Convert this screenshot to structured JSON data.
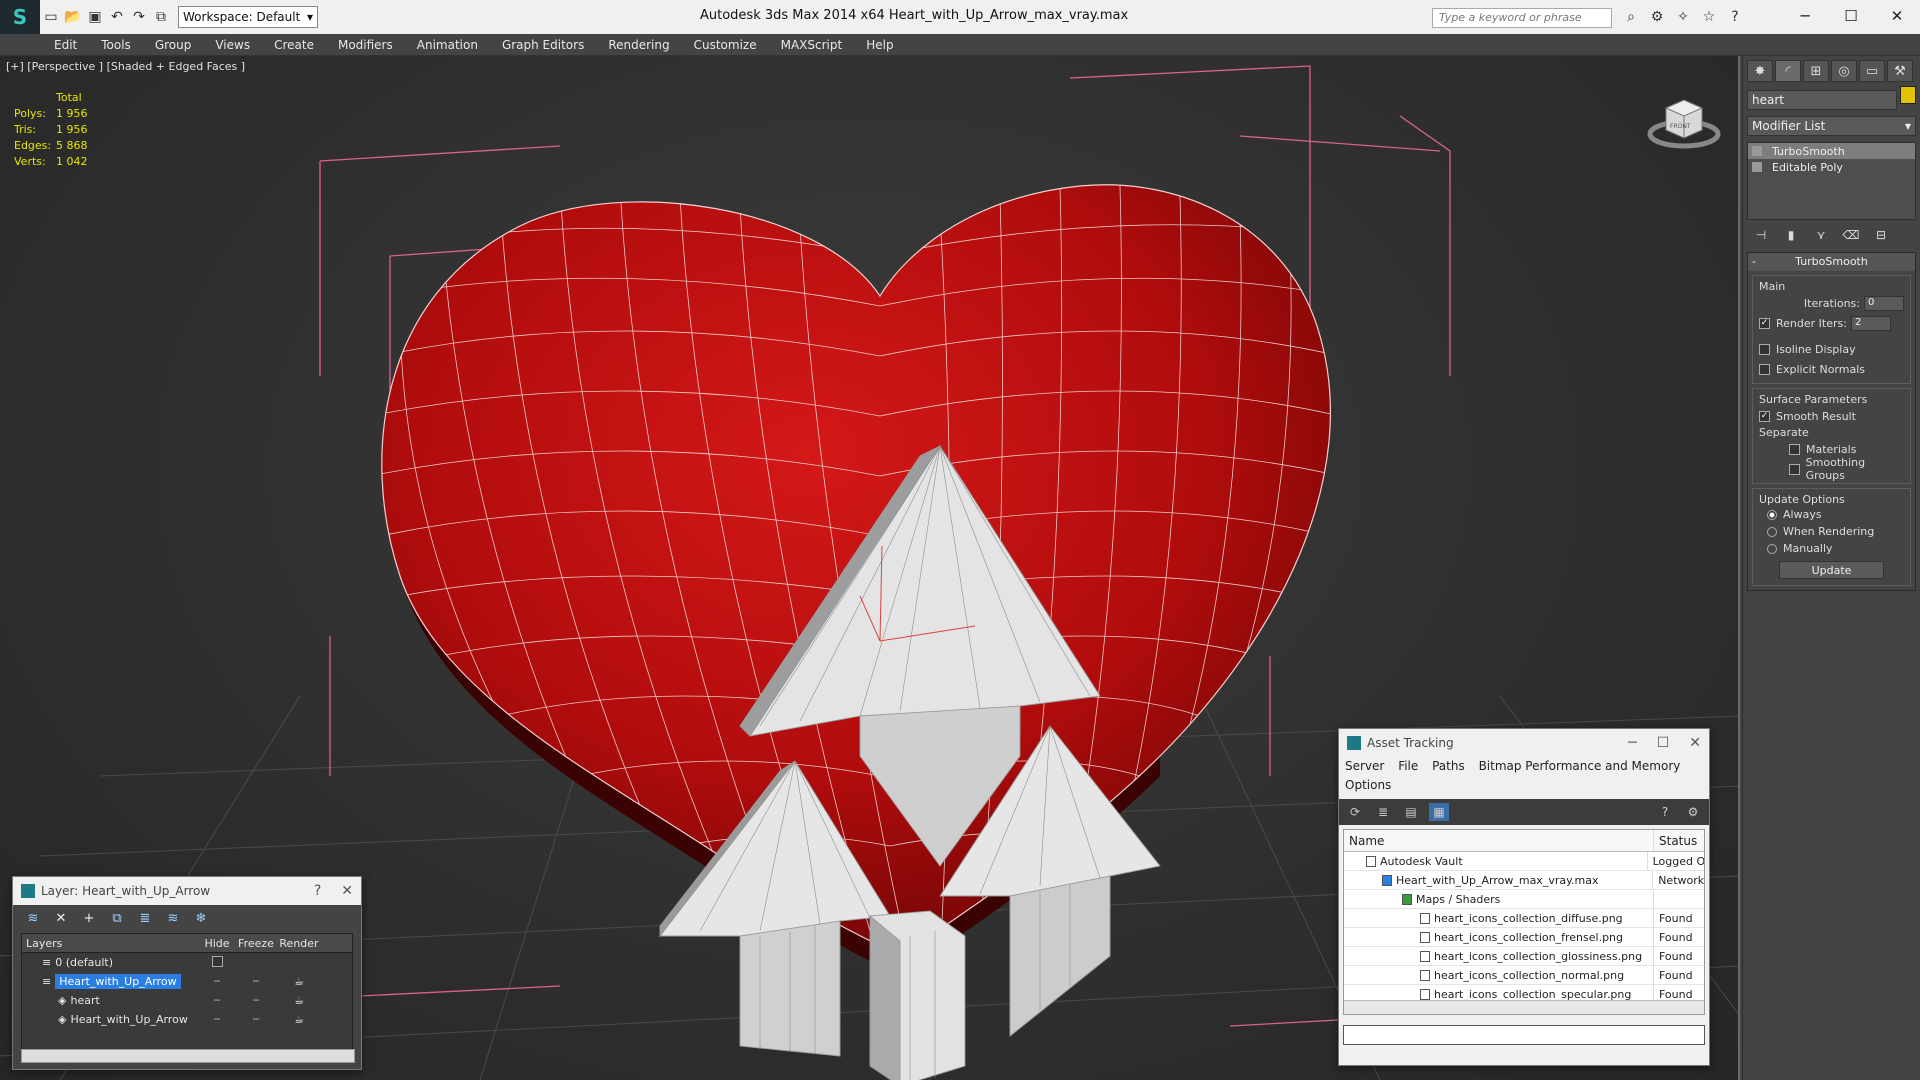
{
  "titlebar": {
    "title": "Autodesk 3ds Max  2014 x64      Heart_with_Up_Arrow_max_vray.max",
    "workspace": "Workspace: Default",
    "search_placeholder": "Type a keyword or phrase"
  },
  "menu": [
    "Edit",
    "Tools",
    "Group",
    "Views",
    "Create",
    "Modifiers",
    "Animation",
    "Graph Editors",
    "Rendering",
    "Customize",
    "MAXScript",
    "Help"
  ],
  "viewport": {
    "label": "[+] [Perspective ] [Shaded + Edged Faces ]",
    "stats_header": "Total",
    "stats": [
      {
        "k": "Polys:",
        "v": "1 956"
      },
      {
        "k": "Tris:",
        "v": "1 956"
      },
      {
        "k": "Edges:",
        "v": "5 868"
      },
      {
        "k": "Verts:",
        "v": "1 042"
      }
    ],
    "viewcube_label": "FRONT"
  },
  "command_panel": {
    "object_name": "heart",
    "object_color": "#e2c300",
    "modifier_list": "Modifier List",
    "stack": [
      {
        "label": "TurboSmooth",
        "selected": true
      },
      {
        "label": "Editable Poly",
        "selected": false
      }
    ],
    "rollout_title": "TurboSmooth",
    "main_title": "Main",
    "iterations_label": "Iterations:",
    "iterations_value": "0",
    "render_iters_label": "Render Iters:",
    "render_iters_value": "2",
    "isoline_label": "Isoline Display",
    "explicit_normals_label": "Explicit Normals",
    "surface_title": "Surface Parameters",
    "smooth_result_label": "Smooth Result",
    "separate_label": "Separate",
    "materials_label": "Materials",
    "smoothing_groups_label": "Smoothing Groups",
    "update_title": "Update Options",
    "always_label": "Always",
    "when_rendering_label": "When Rendering",
    "manually_label": "Manually",
    "update_button": "Update"
  },
  "layer_dialog": {
    "title": "Layer: Heart_with_Up_Arrow",
    "help": "?",
    "close": "✕",
    "columns": [
      "Layers",
      "Hide",
      "Freeze",
      "Render"
    ],
    "rows": [
      {
        "name": "0 (default)",
        "indent": 0
      },
      {
        "name": "Heart_with_Up_Arrow",
        "indent": 0
      },
      {
        "name": "heart",
        "indent": 1
      },
      {
        "name": "Heart_with_Up_Arrow",
        "indent": 1
      }
    ]
  },
  "asset_dialog": {
    "title": "Asset Tracking",
    "menu": [
      "Server",
      "File",
      "Paths",
      "Bitmap Performance and Memory",
      "Options"
    ],
    "columns": [
      "Name",
      "Status"
    ],
    "rows": [
      {
        "name": "Autodesk Vault",
        "status": "Logged O",
        "indent": 1
      },
      {
        "name": "Heart_with_Up_Arrow_max_vray.max",
        "status": "Network",
        "indent": 2
      },
      {
        "name": "Maps / Shaders",
        "status": "",
        "indent": 3
      },
      {
        "name": "heart_icons_collection_diffuse.png",
        "status": "Found",
        "indent": 4
      },
      {
        "name": "heart_icons_collection_frensel.png",
        "status": "Found",
        "indent": 4
      },
      {
        "name": "heart_icons_collection_glossiness.png",
        "status": "Found",
        "indent": 4
      },
      {
        "name": "heart_icons_collection_normal.png",
        "status": "Found",
        "indent": 4
      },
      {
        "name": "heart_icons_collection_specular.png",
        "status": "Found",
        "indent": 4
      }
    ]
  }
}
